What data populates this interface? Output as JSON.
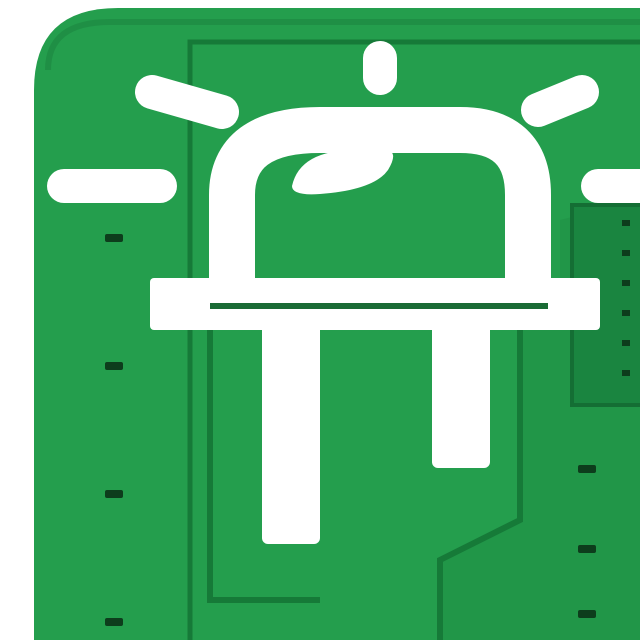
{
  "icon": {
    "name": "led-icon",
    "description_visible_text": ""
  },
  "colors": {
    "board_green": "#249e4d",
    "board_dark": "#157a39",
    "trace_green": "#1f8f45",
    "drill_hole": "#0d3d1c",
    "led_white": "#ffffff",
    "background": "#ffffff"
  }
}
